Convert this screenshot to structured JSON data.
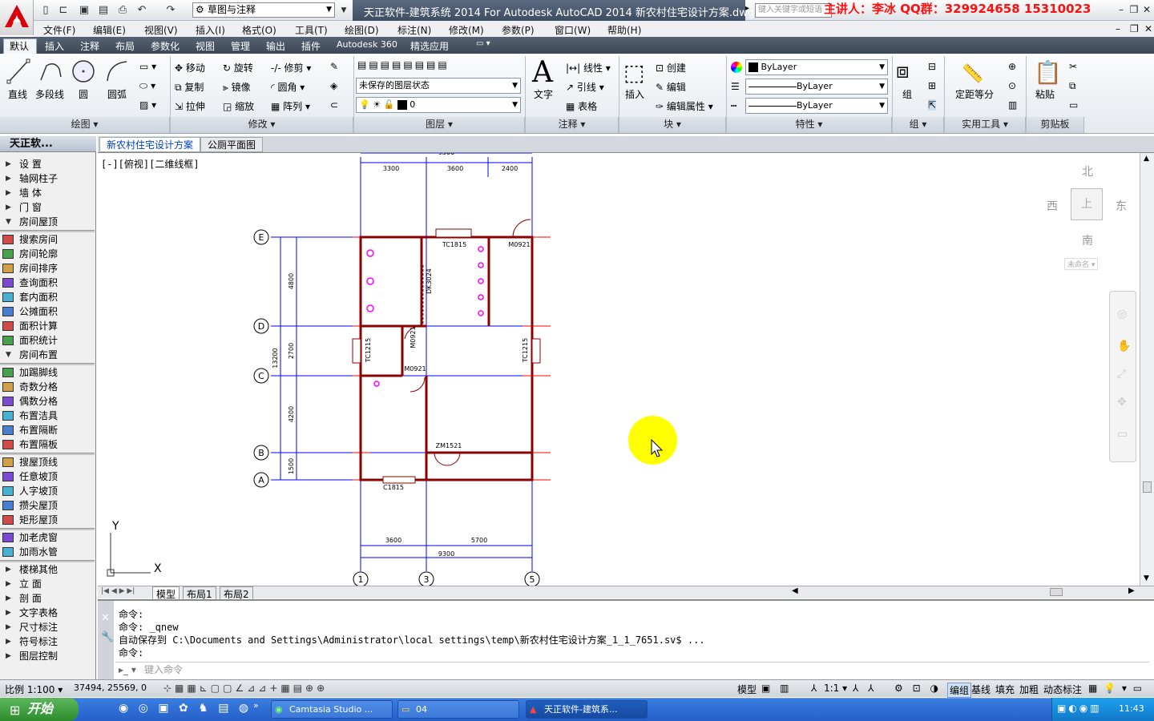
{
  "app": {
    "title": "天正软件-建筑系统 2014  For Autodesk AutoCAD 2014    新农村住宅设计方案.dwg",
    "workspace": "草图与注释",
    "search_placeholder": "键入关键字或短语",
    "overlay_text": "主讲人：李冰   QQ群：329924658   15310023"
  },
  "menu": [
    "文件(F)",
    "编辑(E)",
    "视图(V)",
    "插入(I)",
    "格式(O)",
    "工具(T)",
    "绘图(D)",
    "标注(N)",
    "修改(M)",
    "参数(P)",
    "窗口(W)",
    "帮助(H)"
  ],
  "ribbon_tabs": [
    "默认",
    "插入",
    "注释",
    "布局",
    "参数化",
    "视图",
    "管理",
    "输出",
    "插件",
    "Autodesk 360",
    "精选应用"
  ],
  "ribbon": {
    "draw": {
      "line": "直线",
      "polyline": "多段线",
      "circle": "圆",
      "arc": "圆弧",
      "footer": "绘图 ▾"
    },
    "modify": {
      "move": "移动",
      "rotate": "旋转",
      "trim": "修剪",
      "copy": "复制",
      "mirror": "镜像",
      "fillet": "圆角",
      "stretch": "拉伸",
      "scale": "缩放",
      "array": "阵列",
      "footer": "修改 ▾"
    },
    "layers": {
      "state": "未保存的图层状态",
      "current": "0",
      "footer": "图层 ▾"
    },
    "annotation": {
      "text": "文字",
      "linear": "线性",
      "leader": "引线",
      "table": "表格",
      "footer": "注释 ▾"
    },
    "block": {
      "insert": "插入",
      "create": "创建",
      "edit": "编辑",
      "edit_attr": "编辑属性",
      "footer": "块 ▾"
    },
    "properties": {
      "color": "ByLayer",
      "linetype": "ByLayer",
      "lineweight": "ByLayer",
      "footer": "特性 ▾"
    },
    "group": {
      "group": "组",
      "footer": "组 ▾"
    },
    "utilities": {
      "measure": "定距等分",
      "footer": "实用工具 ▾"
    },
    "clipboard": {
      "paste": "粘贴",
      "footer": "剪贴板"
    }
  },
  "palette": {
    "title": "天正软...",
    "groups": [
      {
        "items": [
          {
            "label": "设    置",
            "type": "tri"
          },
          {
            "label": "轴网柱子",
            "type": "tri"
          },
          {
            "label": "墙    体",
            "type": "tri"
          },
          {
            "label": "门    窗",
            "type": "tri"
          },
          {
            "label": "房间屋顶",
            "type": "open"
          }
        ]
      },
      {
        "items": [
          {
            "label": "搜索房间",
            "type": "icon"
          },
          {
            "label": "房间轮廓",
            "type": "icon"
          },
          {
            "label": "房间排序",
            "type": "icon"
          },
          {
            "label": "查询面积",
            "type": "icon"
          },
          {
            "label": "套内面积",
            "type": "icon"
          },
          {
            "label": "公摊面积",
            "type": "icon"
          },
          {
            "label": "面积计算",
            "type": "icon"
          },
          {
            "label": "面积统计",
            "type": "icon"
          },
          {
            "label": "房间布置",
            "type": "open"
          }
        ]
      },
      {
        "items": [
          {
            "label": "加踢脚线",
            "type": "icon"
          },
          {
            "label": "奇数分格",
            "type": "icon"
          },
          {
            "label": "偶数分格",
            "type": "icon"
          },
          {
            "label": "布置洁具",
            "type": "icon"
          },
          {
            "label": "布置隔断",
            "type": "icon"
          },
          {
            "label": "布置隔板",
            "type": "icon"
          }
        ]
      },
      {
        "items": [
          {
            "label": "搜屋顶线",
            "type": "icon"
          },
          {
            "label": "任意坡顶",
            "type": "icon"
          },
          {
            "label": "人字坡顶",
            "type": "icon"
          },
          {
            "label": "攒尖屋顶",
            "type": "icon"
          },
          {
            "label": "矩形屋顶",
            "type": "icon"
          }
        ]
      },
      {
        "items": [
          {
            "label": "加老虎窗",
            "type": "icon"
          },
          {
            "label": "加雨水管",
            "type": "icon"
          }
        ]
      },
      {
        "items": [
          {
            "label": "楼梯其他",
            "type": "tri"
          },
          {
            "label": "立    面",
            "type": "tri"
          },
          {
            "label": "剖    面",
            "type": "tri"
          },
          {
            "label": "文字表格",
            "type": "tri"
          },
          {
            "label": "尺寸标注",
            "type": "tri"
          },
          {
            "label": "符号标注",
            "type": "tri"
          },
          {
            "label": "图层控制",
            "type": "tri"
          }
        ]
      }
    ]
  },
  "doc_tabs": [
    "新农村住宅设计方案",
    "公厕平面图"
  ],
  "viewport_label": "[-][俯视][二维线框]",
  "viewcube": {
    "north": "北",
    "south": "南",
    "east": "东",
    "west": "西",
    "top": "上",
    "wcs": "未命名 ▾"
  },
  "drawing": {
    "axes_h": [
      "E",
      "D",
      "C",
      "B",
      "A"
    ],
    "axes_v": [
      "1",
      "3",
      "5"
    ],
    "dims_top": [
      "3300",
      "3600",
      "2400"
    ],
    "dim_total_top": "9300",
    "dims_left": [
      "4800",
      "2700",
      "4200",
      "1500"
    ],
    "dim_total_left": "13200",
    "dims_bottom": [
      "3600",
      "5700"
    ],
    "dim_total_bottom": "9300",
    "labels": {
      "tc1815": "TC1815",
      "m0921a": "M0921",
      "dk3024": "DK3024",
      "tc1215a": "TC1215",
      "m0921b": "M0921",
      "m0921c": "M0921",
      "tc1215b": "TC1215",
      "zm1521": "ZM1521",
      "c1815": "C1815"
    },
    "ucs_x": "X",
    "ucs_y": "Y"
  },
  "layout_tabs": [
    "模型",
    "布局1",
    "布局2"
  ],
  "command": {
    "lines": [
      "命令: _qnew",
      "自动保存到 C:\\Documents and Settings\\Administrator\\local settings\\temp\\新农村住宅设计方案_1_1_7651.sv$ ...",
      "命令:"
    ],
    "first": "命令:",
    "placeholder": "键入命令"
  },
  "status": {
    "scale": "比例 1:100 ▾",
    "coords": "37494, 25569, 0",
    "model": "模型",
    "annoscale": "1:1 ▾",
    "buttons": [
      "编组",
      "基线",
      "填充",
      "加粗",
      "动态标注"
    ]
  },
  "taskbar": {
    "start": "开始",
    "tasks": [
      "Camtasia Studio ...",
      "04",
      "天正软件-建筑系..."
    ],
    "clock": "11:43"
  },
  "colors": {
    "accent": "#d9000d",
    "axis_blue": "#0000ff",
    "axis_red": "#ff0000",
    "fixture_magenta": "#ff00ff",
    "wall_brown": "#8b0000"
  }
}
